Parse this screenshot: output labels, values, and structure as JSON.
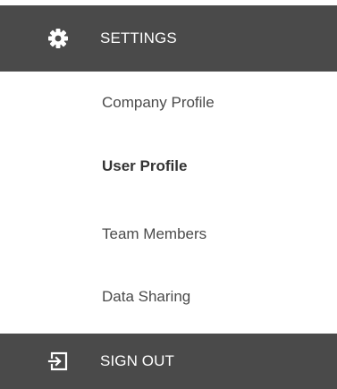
{
  "settings": {
    "label": "SETTINGS",
    "icon": "gear-icon"
  },
  "menu_items": [
    {
      "label": "Company Profile",
      "active": false
    },
    {
      "label": "User Profile",
      "active": true
    },
    {
      "label": "Team Members",
      "active": false
    },
    {
      "label": "Data Sharing",
      "active": false
    }
  ],
  "sign_out": {
    "label": "SIGN OUT",
    "icon": "sign-out-icon"
  },
  "colors": {
    "bar_background": "#4a4a4a",
    "bar_text": "#ffffff",
    "item_text": "#4a4a4a"
  }
}
